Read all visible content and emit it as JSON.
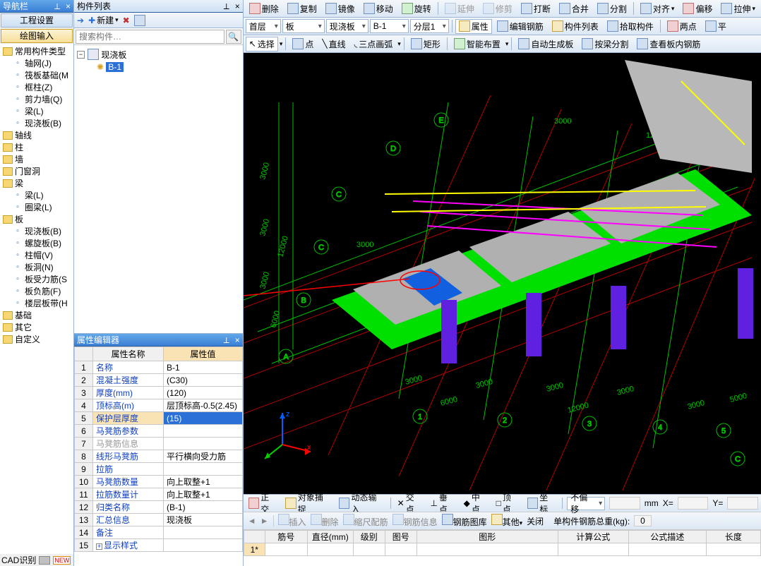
{
  "nav": {
    "title": "导航栏",
    "engineering": "工程设置",
    "drawing": "绘图输入",
    "cats": [
      {
        "label": "常用构件类型",
        "items": [
          {
            "label": "轴网(J)"
          },
          {
            "label": "筏板基础(M"
          },
          {
            "label": "框柱(Z)"
          },
          {
            "label": "剪力墙(Q)"
          },
          {
            "label": "梁(L)"
          },
          {
            "label": "现浇板(B)"
          }
        ]
      },
      {
        "label": "轴线",
        "items": []
      },
      {
        "label": "柱",
        "items": []
      },
      {
        "label": "墙",
        "items": []
      },
      {
        "label": "门窗洞",
        "items": []
      },
      {
        "label": "梁",
        "items": [
          {
            "label": "梁(L)"
          },
          {
            "label": "圈梁(L)"
          }
        ]
      },
      {
        "label": "板",
        "items": [
          {
            "label": "现浇板(B)"
          },
          {
            "label": "螺旋板(B)"
          },
          {
            "label": "柱帽(V)"
          },
          {
            "label": "板洞(N)"
          },
          {
            "label": "板受力筋(S"
          },
          {
            "label": "板负筋(F)"
          },
          {
            "label": "楼层板带(H"
          }
        ]
      },
      {
        "label": "基础",
        "items": []
      },
      {
        "label": "其它",
        "items": []
      },
      {
        "label": "自定义",
        "items": []
      }
    ],
    "cad": "CAD识别"
  },
  "complist": {
    "title": "构件列表",
    "new": "新建",
    "search_ph": "搜索构件…",
    "root": "现浇板",
    "child": "B-1"
  },
  "prop": {
    "title": "属性编辑器",
    "col_name": "属性名称",
    "col_value": "属性值",
    "rows": [
      {
        "n": "1",
        "name": "名称",
        "val": "B-1"
      },
      {
        "n": "2",
        "name": "混凝土强度",
        "val": "(C30)"
      },
      {
        "n": "3",
        "name": "厚度(mm)",
        "val": "(120)"
      },
      {
        "n": "4",
        "name": "顶标高(m)",
        "val": "层顶标高-0.5(2.45)"
      },
      {
        "n": "5",
        "name": "保护层厚度",
        "val": "(15)",
        "hl": true
      },
      {
        "n": "6",
        "name": "马凳筋参数",
        "val": ""
      },
      {
        "n": "7",
        "name": "马凳筋信息",
        "val": "",
        "dis": true
      },
      {
        "n": "8",
        "name": "线形马凳筋",
        "val": "平行横向受力筋"
      },
      {
        "n": "9",
        "name": "拉筋",
        "val": ""
      },
      {
        "n": "10",
        "name": "马凳筋数量",
        "val": "向上取整+1"
      },
      {
        "n": "11",
        "name": "拉筋数量计",
        "val": "向上取整+1"
      },
      {
        "n": "12",
        "name": "归类名称",
        "val": "(B-1)"
      },
      {
        "n": "13",
        "name": "汇总信息",
        "val": "现浇板"
      },
      {
        "n": "14",
        "name": "备注",
        "val": ""
      },
      {
        "n": "15",
        "name": "显示样式",
        "val": "",
        "exp": true
      }
    ]
  },
  "tb1": {
    "del": "删除",
    "copy": "复制",
    "mirror": "镜像",
    "move": "移动",
    "rotate": "旋转",
    "extend": "延伸",
    "trim": "修剪",
    "break": "打断",
    "merge": "合并",
    "split": "分割",
    "align": "对齐",
    "offset": "偏移",
    "stretch": "拉伸"
  },
  "tb2": {
    "floor": "首层",
    "comp": "板",
    "sub": "现浇板",
    "name": "B-1",
    "layer": "分层1",
    "prop": "属性",
    "editrebar": "编辑钢筋",
    "list": "构件列表",
    "pick": "拾取构件",
    "twopt": "两点",
    "plane": "平"
  },
  "tb3": {
    "select": "选择",
    "point": "点",
    "line": "直线",
    "arc": "三点画弧",
    "rect": "矩形",
    "smart": "智能布置",
    "autogen": "自动生成板",
    "beamsplit": "按梁分割",
    "viewrebar": "查看板内钢筋"
  },
  "status": {
    "ortho": "正交",
    "osnap": "对象捕捉",
    "dyninput": "动态输入",
    "xpt": "交点",
    "perp": "垂点",
    "mid": "中点",
    "top": "顶点",
    "coord": "坐标",
    "nooffset": "不偏移",
    "mm": "mm",
    "xlbl": "X=",
    "ylbl": "Y="
  },
  "rebar_tb": {
    "insert": "插入",
    "del": "删除",
    "scale": "缩尺配筋",
    "info": "钢筋信息",
    "lib": "钢筋图库",
    "other": "其他",
    "close": "关闭",
    "sum": "单构件钢筋总重(kg):",
    "zero": "0"
  },
  "rebar_grid": {
    "cols": [
      "筋号",
      "直径(mm)",
      "级别",
      "图号",
      "图形",
      "计算公式",
      "公式描述",
      "长度"
    ],
    "row1": "1*"
  },
  "grid_labels": {
    "rows": [
      "A",
      "B",
      "C",
      "D",
      "E"
    ],
    "cols": [
      "1",
      "2",
      "3",
      "4",
      "5"
    ],
    "d3000": "3000",
    "d6000": "6000",
    "d12000": "12000",
    "d5000": "5000"
  }
}
